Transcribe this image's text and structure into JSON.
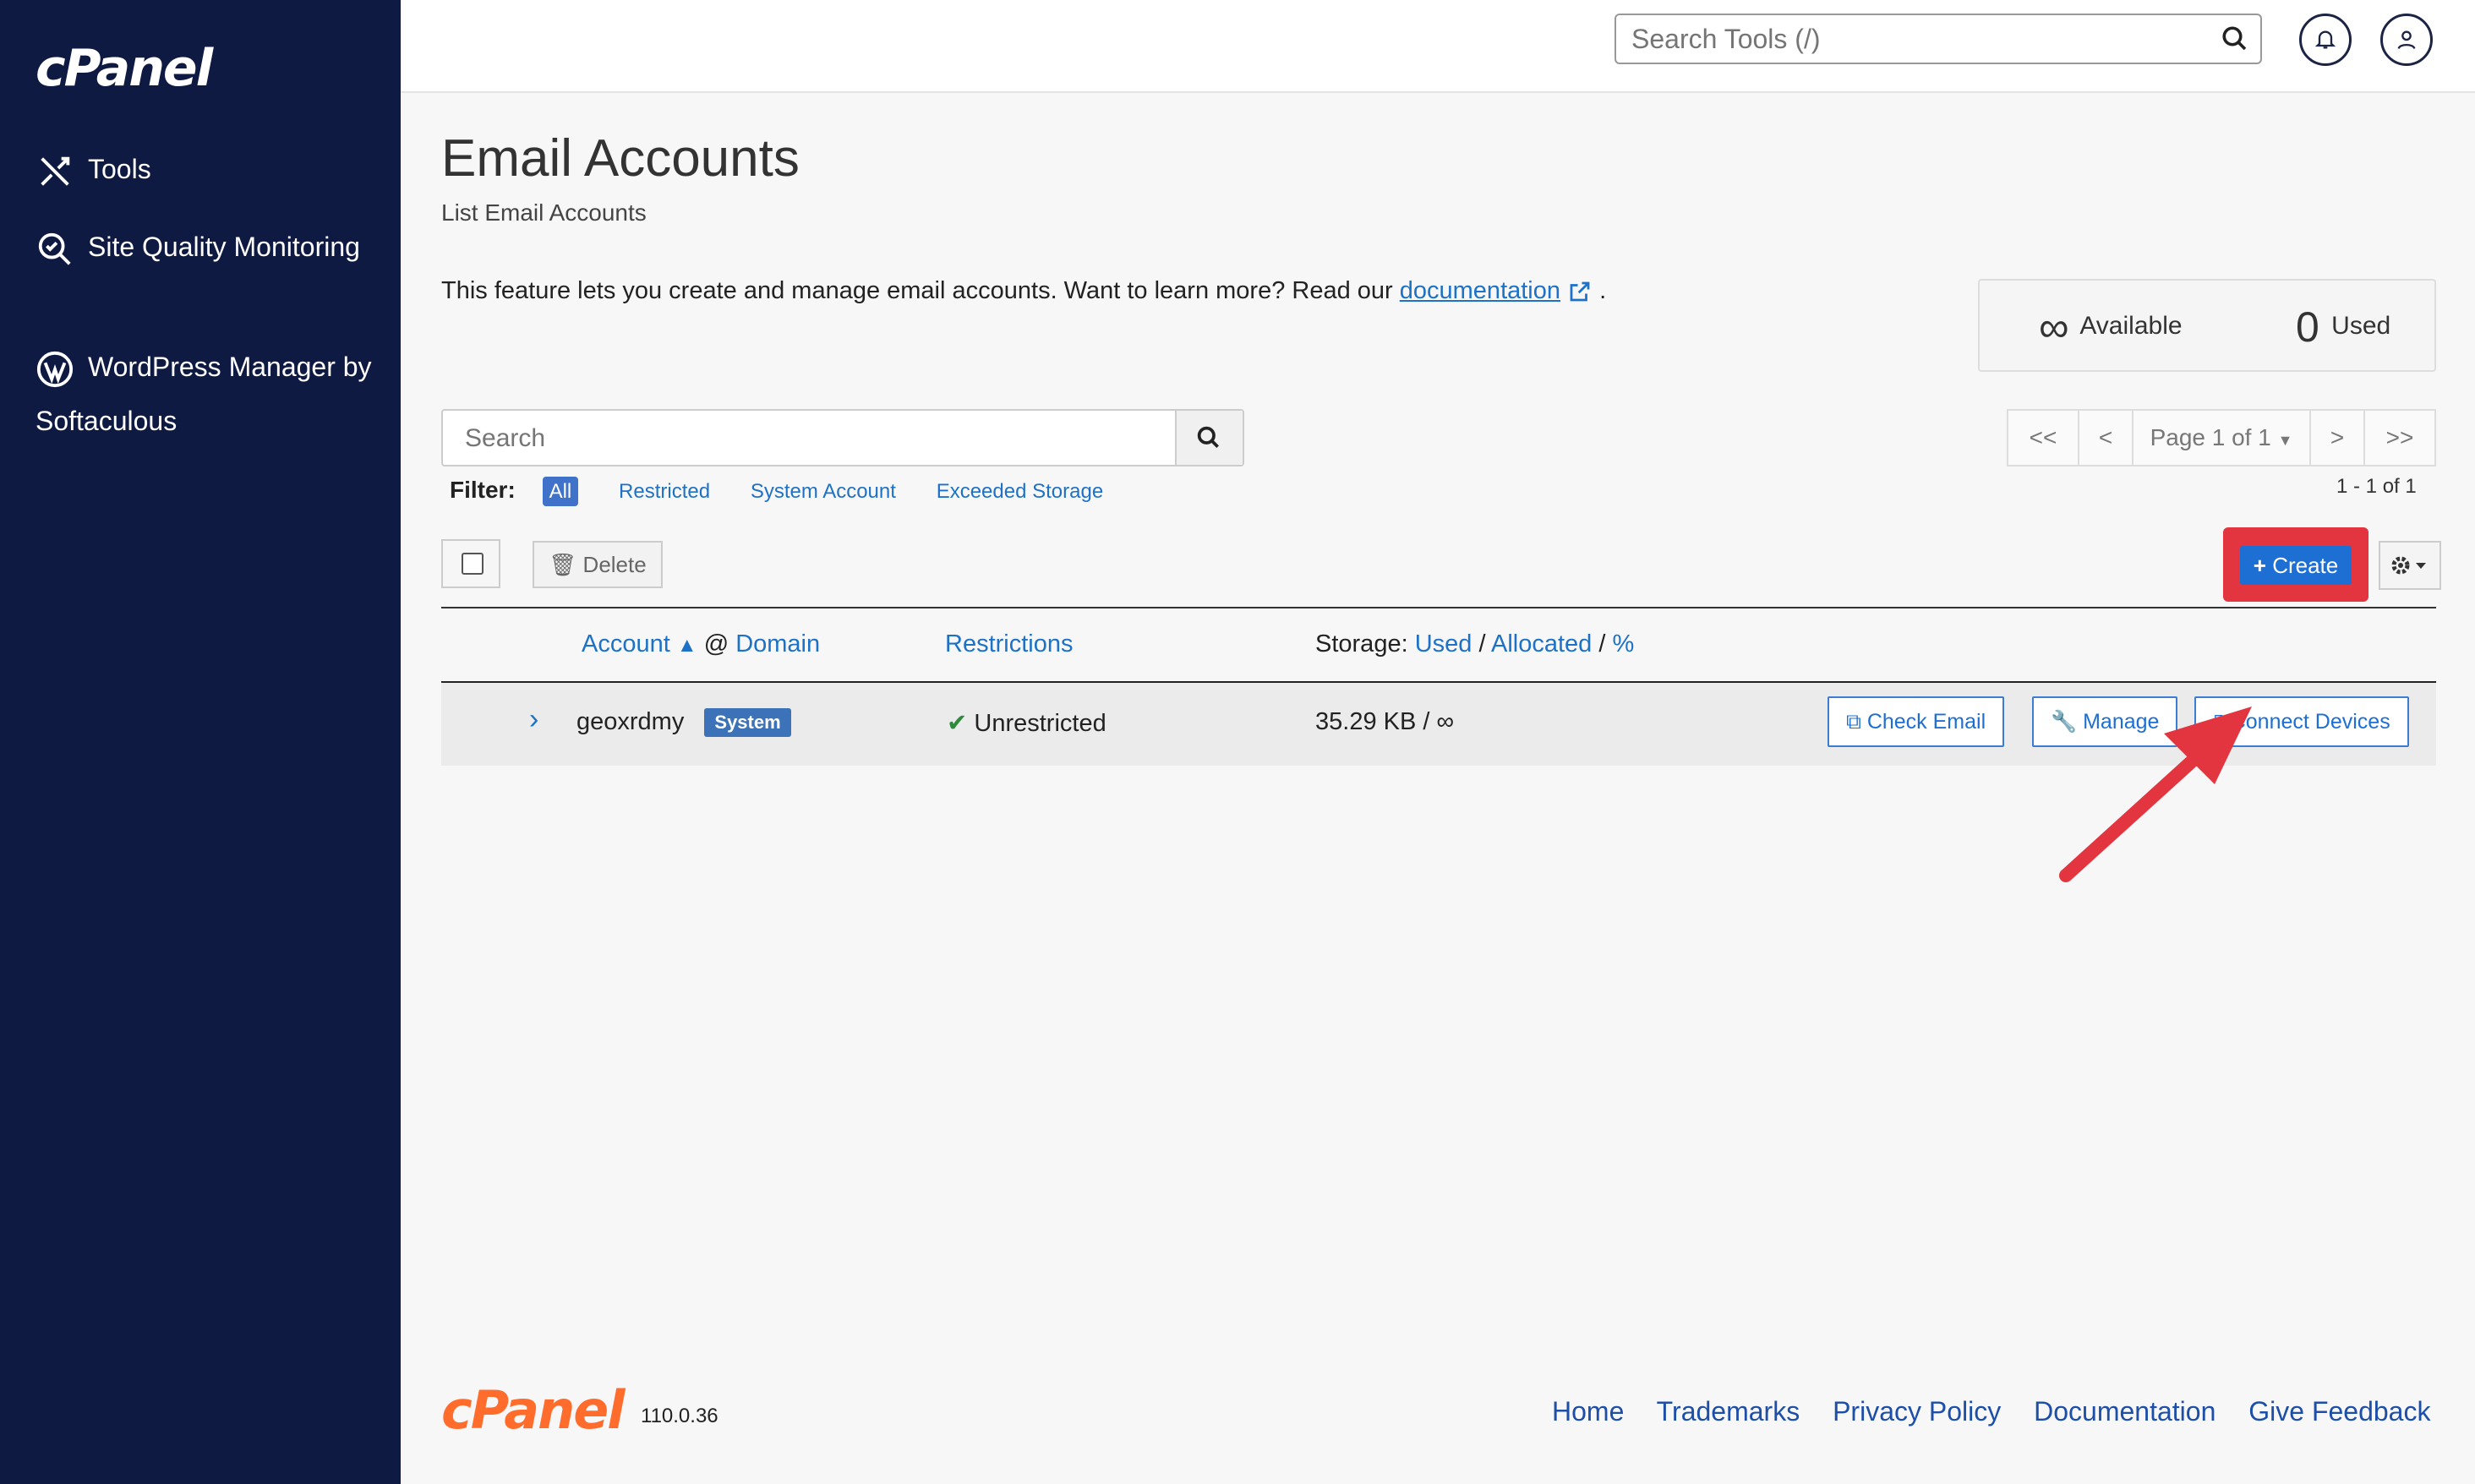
{
  "sidebar": {
    "logo": "cPanel",
    "items": [
      {
        "label": "Tools",
        "icon": "tools-icon"
      },
      {
        "label": "Site Quality Monitoring",
        "icon": "site-quality-icon"
      },
      {
        "label": "WordPress Manager by Softaculous",
        "icon": "wordpress-icon"
      }
    ]
  },
  "header": {
    "search_placeholder": "Search Tools (/)"
  },
  "page": {
    "title": "Email Accounts",
    "subtitle": "List Email Accounts",
    "intro_text": "This feature lets you create and manage email accounts. Want to learn more? Read our",
    "intro_link": "documentation",
    "intro_end": "."
  },
  "stats": {
    "available_value": "∞",
    "available_label": "Available",
    "used_value": "0",
    "used_label": "Used"
  },
  "search": {
    "placeholder": "Search"
  },
  "pager": {
    "first": "<<",
    "prev": "<",
    "page": "Page 1 of 1",
    "next": ">",
    "last": ">>",
    "count": "1 - 1 of 1"
  },
  "filter": {
    "label": "Filter:",
    "options": [
      "All",
      "Restricted",
      "System Account",
      "Exceeded Storage"
    ]
  },
  "toolbar": {
    "delete_label": "Delete",
    "create_label": "Create"
  },
  "table": {
    "headers": {
      "account": "Account",
      "at": "@",
      "domain": "Domain",
      "restrictions": "Restrictions",
      "storage": "Storage:",
      "used": "Used",
      "sep1": "/",
      "allocated": "Allocated",
      "sep2": "/",
      "percent": "%"
    },
    "rows": [
      {
        "account": "geoxrdmy",
        "badge": "System",
        "restriction": "Unrestricted",
        "storage": "35.29 KB / ∞",
        "actions": [
          "Check Email",
          "Manage",
          "Connect Devices"
        ]
      }
    ]
  },
  "footer": {
    "logo": "cPanel",
    "version": "110.0.36",
    "links": [
      "Home",
      "Trademarks",
      "Privacy Policy",
      "Documentation",
      "Give Feedback"
    ]
  },
  "colors": {
    "sidebar_bg": "#0f1a42",
    "link": "#1d72c7",
    "create_btn": "#1d6fd4",
    "highlight": "#e2353f",
    "footer_logo": "#ff6c2c"
  }
}
